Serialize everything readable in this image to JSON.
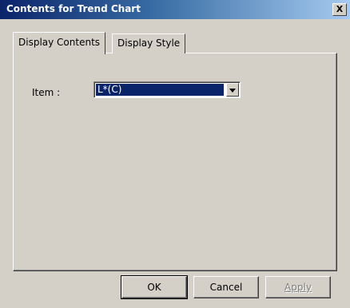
{
  "window": {
    "title": "Contents for Trend Chart",
    "close_glyph": "X"
  },
  "tabs": [
    {
      "label": "Display Contents",
      "active": true
    },
    {
      "label": "Display Style",
      "active": false
    }
  ],
  "panel": {
    "item_label": "Item :",
    "item_value": "L*(C)"
  },
  "buttons": {
    "ok": "OK",
    "cancel": "Cancel",
    "apply": "Apply",
    "apply_enabled": false
  },
  "colors": {
    "title_bar_start": "#0a246a",
    "title_bar_end": "#a6caf0",
    "face": "#d4d0c8",
    "selection": "#0a246a"
  }
}
